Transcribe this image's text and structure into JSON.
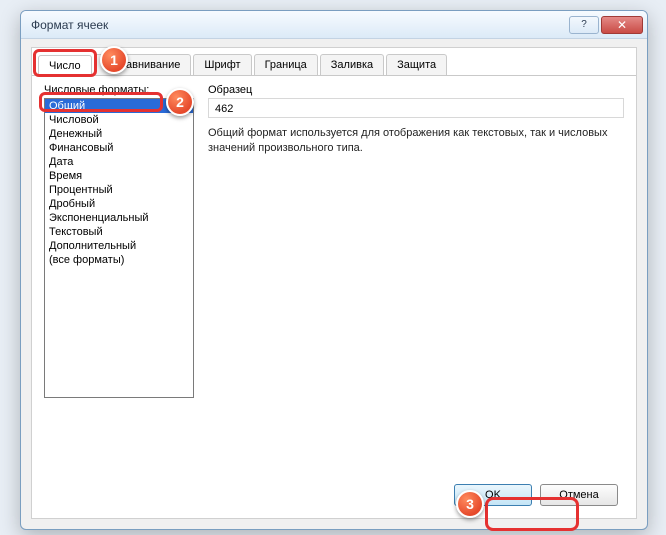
{
  "window": {
    "title": "Формат ячеек",
    "help_icon": "?",
    "close_icon": "✕"
  },
  "tabs": [
    {
      "label": "Число",
      "active": true
    },
    {
      "label": "Выравнивание",
      "active": false
    },
    {
      "label": "Шрифт",
      "active": false
    },
    {
      "label": "Граница",
      "active": false
    },
    {
      "label": "Заливка",
      "active": false
    },
    {
      "label": "Защита",
      "active": false
    }
  ],
  "formats": {
    "label": "Числовые форматы:",
    "items": [
      "Общий",
      "Числовой",
      "Денежный",
      "Финансовый",
      "Дата",
      "Время",
      "Процентный",
      "Дробный",
      "Экспоненциальный",
      "Текстовый",
      "Дополнительный",
      "(все форматы)"
    ],
    "selected_index": 0
  },
  "sample": {
    "label": "Образец",
    "value": "462"
  },
  "description": "Общий формат используется для отображения как текстовых, так и числовых значений произвольного типа.",
  "buttons": {
    "ok": "OK",
    "cancel": "Отмена"
  },
  "annotations": {
    "badge1": "1",
    "badge2": "2",
    "badge3": "3"
  }
}
